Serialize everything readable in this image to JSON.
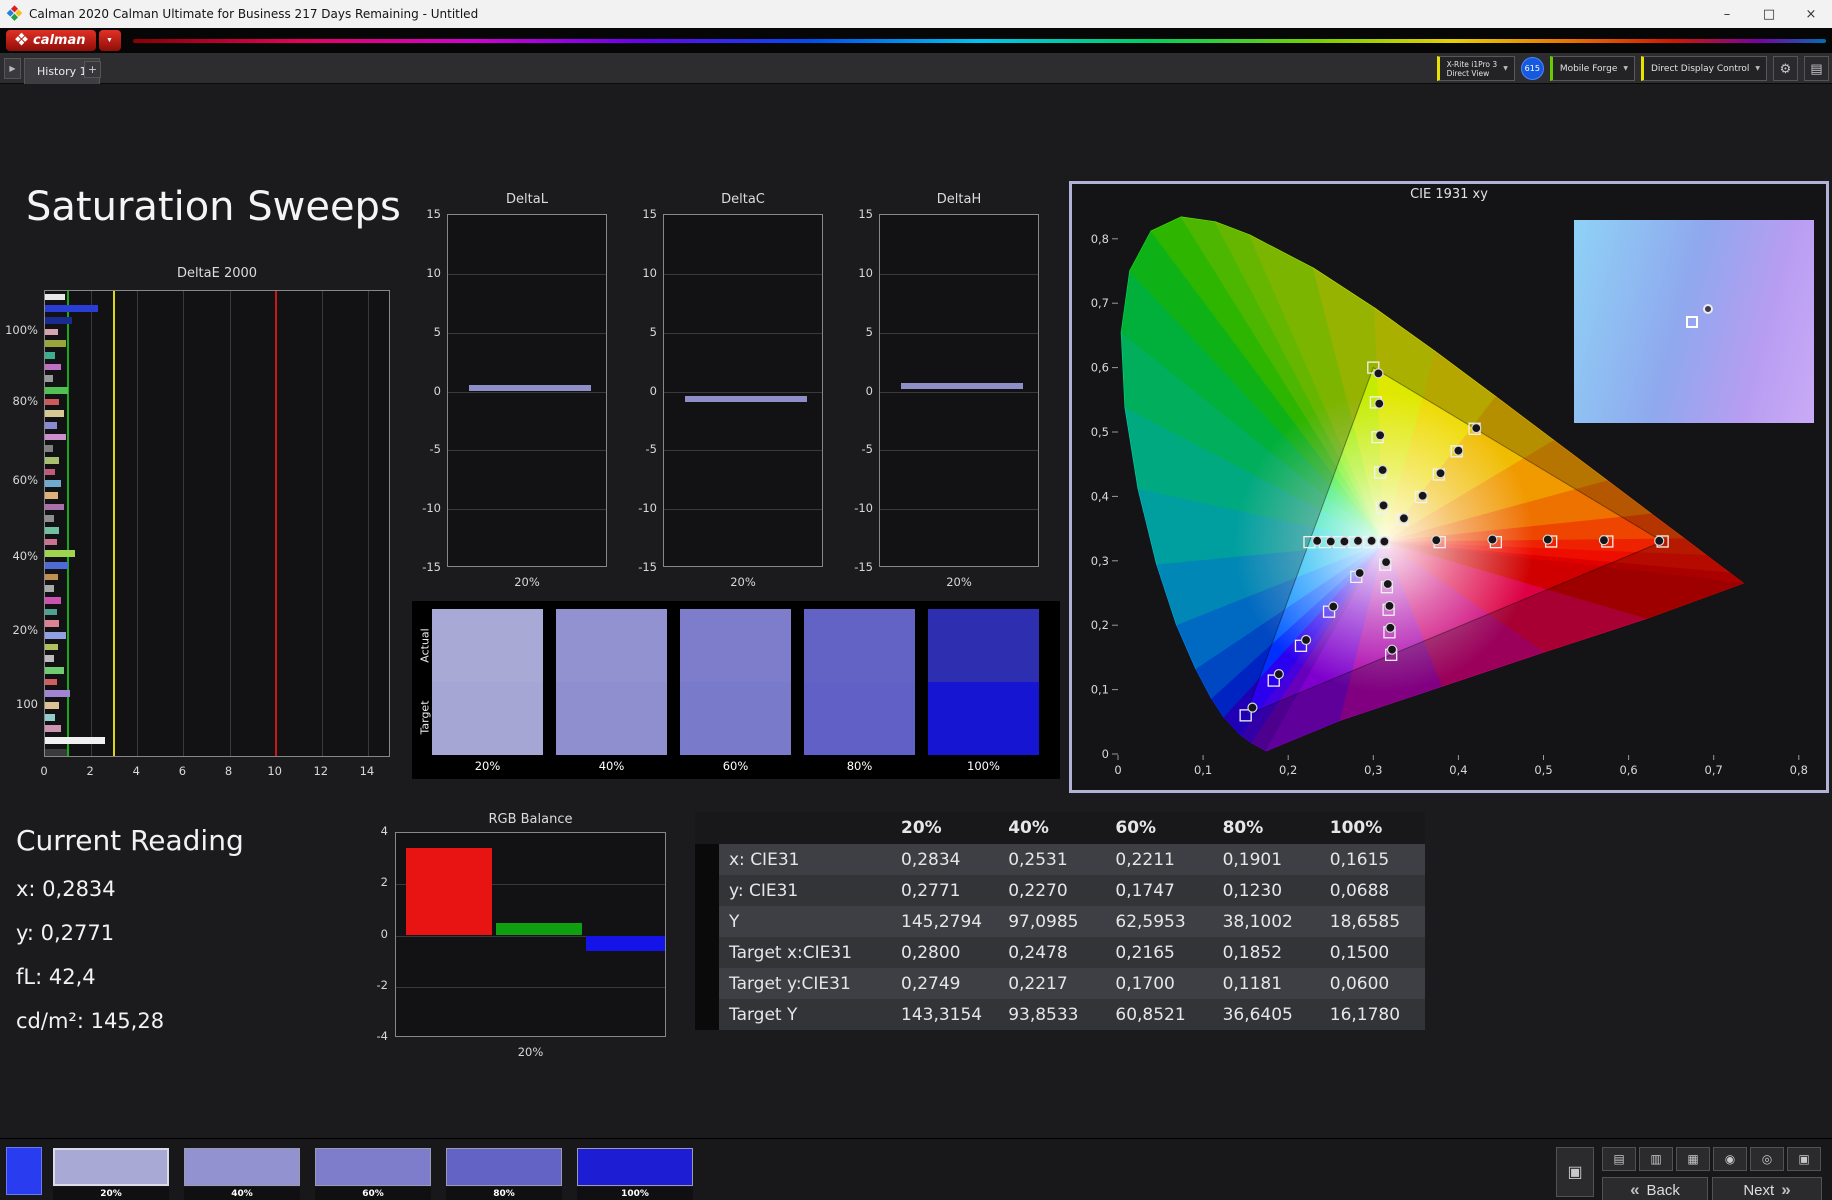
{
  "window": {
    "title": "Calman 2020 Calman Ultimate for Business 217 Days Remaining - Untitled",
    "controls": {
      "minimize": "–",
      "maximize": "□",
      "close": "×"
    }
  },
  "brand": {
    "logo_text": "calman",
    "caret": "▼"
  },
  "tab_bar": {
    "nav_glyph": "▶",
    "tab": "History 1",
    "add_tab": "+",
    "meter": {
      "line1": "X-Rite i1Pro 3",
      "line2": "Direct View",
      "stripe": "#e8e000"
    },
    "badge": "615",
    "source": {
      "label": "Mobile Forge",
      "stripe": "#66cc00"
    },
    "control": {
      "label": "Direct Display Control",
      "stripe": "#e8e000"
    },
    "gear_glyph": "⚙",
    "panel_glyph": "▤",
    "caret": "▼"
  },
  "page": {
    "title": "Saturation Sweeps"
  },
  "current_reading": {
    "title": "Current Reading",
    "lines": [
      "x: 0,2834",
      "y: 0,2771",
      "fL: 42,4",
      "cd/m²: 145,28"
    ]
  },
  "chart_data": [
    {
      "type": "bar",
      "orientation": "horizontal",
      "title": "DeltaE 2000",
      "xlim": [
        0,
        15
      ],
      "xticks": [
        0,
        2,
        4,
        6,
        8,
        10,
        12,
        14
      ],
      "group_labels": [
        "100%",
        "80%",
        "60%",
        "40%",
        "20%",
        "100"
      ],
      "group_fractions": [
        0.088,
        0.239,
        0.41,
        0.571,
        0.731,
        0.889
      ],
      "ref_lines": [
        {
          "value": 1,
          "color": "#18a818"
        },
        {
          "value": 3,
          "color": "#d8d818"
        },
        {
          "value": 10,
          "color": "#c81818"
        }
      ],
      "bars": [
        [
          "#e8e8e8",
          0.85
        ],
        [
          "#2a3dd4",
          2.3
        ],
        [
          "#1b2a8e",
          1.15
        ],
        [
          "#d6a4b0",
          0.55
        ],
        [
          "#9aa43c",
          0.9
        ],
        [
          "#3cb08e",
          0.45
        ],
        [
          "#c070c0",
          0.7
        ],
        [
          "#9a9a9a",
          0.35
        ],
        [
          "#52c052",
          1.0
        ],
        [
          "#cc5a5a",
          0.6
        ],
        [
          "#d8c894",
          0.8
        ],
        [
          "#8a8ad0",
          0.5
        ],
        [
          "#cc8ecc",
          0.9
        ],
        [
          "#808080",
          0.35
        ],
        [
          "#a6c070",
          0.6
        ],
        [
          "#c05a78",
          0.45
        ],
        [
          "#70aacc",
          0.7
        ],
        [
          "#ddb07c",
          0.55
        ],
        [
          "#aa70aa",
          0.8
        ],
        [
          "#8e8e8e",
          0.4
        ],
        [
          "#70c0a0",
          0.6
        ],
        [
          "#cc7290",
          0.5
        ],
        [
          "#a0d44e",
          1.3
        ],
        [
          "#4e6ad4",
          1.0
        ],
        [
          "#c09052",
          0.55
        ],
        [
          "#aaaaaa",
          0.4
        ],
        [
          "#cc52b0",
          0.7
        ],
        [
          "#4ea090",
          0.5
        ],
        [
          "#dd8294",
          0.6
        ],
        [
          "#90a0e0",
          0.9
        ],
        [
          "#b0c060",
          0.55
        ],
        [
          "#bcbcbc",
          0.4
        ],
        [
          "#70cc70",
          0.8
        ],
        [
          "#cc6060",
          0.5
        ],
        [
          "#a284d4",
          1.1
        ],
        [
          "#ddc094",
          0.6
        ],
        [
          "#94cccc",
          0.45
        ],
        [
          "#cc94b0",
          0.7
        ],
        [
          "#f0f0f0",
          2.6
        ],
        [
          "#3a3a3a",
          0.95
        ]
      ]
    },
    {
      "type": "bar",
      "title": "DeltaL",
      "ylim": [
        -15,
        15
      ],
      "yticks": [
        15,
        10,
        5,
        0,
        -5,
        -10,
        -15
      ],
      "categories": [
        "20%"
      ],
      "values": [
        0.3
      ],
      "color": "#8e8ec8"
    },
    {
      "type": "bar",
      "title": "DeltaC",
      "ylim": [
        -15,
        15
      ],
      "yticks": [
        15,
        10,
        5,
        0,
        -5,
        -10,
        -15
      ],
      "categories": [
        "20%"
      ],
      "values": [
        -0.6
      ],
      "color": "#8e8ec8"
    },
    {
      "type": "bar",
      "title": "DeltaH",
      "ylim": [
        -15,
        15
      ],
      "yticks": [
        15,
        10,
        5,
        0,
        -5,
        -10,
        -15
      ],
      "categories": [
        "20%"
      ],
      "values": [
        0.5
      ],
      "color": "#8e8ec8"
    },
    {
      "type": "bar",
      "title": "RGB Balance",
      "ylim": [
        -4,
        4
      ],
      "yticks": [
        4,
        2,
        0,
        -2,
        -4
      ],
      "categories": [
        "20%"
      ],
      "series": [
        {
          "name": "Red",
          "color": "#e81414",
          "values": [
            3.4
          ]
        },
        {
          "name": "Green",
          "color": "#0fa00f",
          "values": [
            0.5
          ]
        },
        {
          "name": "Blue",
          "color": "#1414e8",
          "values": [
            -0.6
          ]
        }
      ]
    },
    {
      "type": "scatter",
      "title": "CIE 1931 xy",
      "xlim": [
        0,
        0.8
      ],
      "ylim": [
        0,
        0.8
      ],
      "xticks": [
        "0",
        "0,1",
        "0,2",
        "0,3",
        "0,4",
        "0,5",
        "0,6",
        "0,7",
        "0,8"
      ],
      "yticks": [
        "0",
        "0,1",
        "0,2",
        "0,3",
        "0,4",
        "0,5",
        "0,6",
        "0,7",
        "0,8"
      ],
      "white_point": [
        0.3127,
        0.329
      ],
      "srgb_triangle": [
        [
          0.64,
          0.33
        ],
        [
          0.3,
          0.6
        ],
        [
          0.15,
          0.06
        ]
      ],
      "locus": [
        [
          0.1741,
          0.005,
          "#6600bb"
        ],
        [
          0.1566,
          0.0177,
          "#4400dd"
        ],
        [
          0.144,
          0.0297,
          "#2a00ee"
        ],
        [
          0.1241,
          0.0578,
          "#0030ff"
        ],
        [
          0.1096,
          0.0868,
          "#005eff"
        ],
        [
          0.0913,
          0.1327,
          "#008cff"
        ],
        [
          0.0687,
          0.2007,
          "#00b2f0"
        ],
        [
          0.0454,
          0.295,
          "#00d2d2"
        ],
        [
          0.0235,
          0.4127,
          "#00dfa8"
        ],
        [
          0.0082,
          0.5384,
          "#00e57a"
        ],
        [
          0.0039,
          0.6548,
          "#00e84e"
        ],
        [
          0.0139,
          0.7502,
          "#14ea1e"
        ],
        [
          0.0389,
          0.812,
          "#3cee00"
        ],
        [
          0.0743,
          0.8338,
          "#64f000"
        ],
        [
          0.1142,
          0.8262,
          "#86f000"
        ],
        [
          0.1547,
          0.8059,
          "#a4ee00"
        ],
        [
          0.2296,
          0.7543,
          "#c4ec00"
        ],
        [
          0.3016,
          0.6923,
          "#dfe800"
        ],
        [
          0.3731,
          0.6245,
          "#eeda00"
        ],
        [
          0.4441,
          0.5547,
          "#f0bc00"
        ],
        [
          0.5125,
          0.4866,
          "#f09a00"
        ],
        [
          0.5752,
          0.4242,
          "#ee7200"
        ],
        [
          0.627,
          0.3725,
          "#ee4600"
        ],
        [
          0.6658,
          0.334,
          "#ee2200"
        ],
        [
          0.6915,
          0.3083,
          "#ee0e00"
        ],
        [
          0.719,
          0.2809,
          "#e00000"
        ],
        [
          0.7347,
          0.2653,
          "#d00000"
        ],
        [
          0.62,
          0.21,
          "#dd0044"
        ],
        [
          0.5,
          0.158,
          "#cc0077"
        ],
        [
          0.38,
          0.105,
          "#aa00aa"
        ],
        [
          0.26,
          0.052,
          "#7f00cc"
        ]
      ],
      "sweeps": [
        {
          "name": "red",
          "targets": [
            [
              0.378,
              0.329
            ],
            [
              0.444,
              0.329
            ],
            [
              0.509,
              0.33
            ],
            [
              0.575,
              0.33
            ],
            [
              0.64,
              0.33
            ]
          ],
          "measured": [
            [
              0.374,
              0.332
            ],
            [
              0.44,
              0.333
            ],
            [
              0.505,
              0.333
            ],
            [
              0.571,
              0.332
            ],
            [
              0.636,
              0.331
            ]
          ]
        },
        {
          "name": "green",
          "targets": [
            [
              0.31,
              0.383
            ],
            [
              0.308,
              0.437
            ],
            [
              0.305,
              0.492
            ],
            [
              0.303,
              0.546
            ],
            [
              0.3,
              0.6
            ]
          ],
          "measured": [
            [
              0.312,
              0.386
            ],
            [
              0.311,
              0.441
            ],
            [
              0.308,
              0.495
            ],
            [
              0.307,
              0.544
            ],
            [
              0.306,
              0.591
            ]
          ]
        },
        {
          "name": "blue",
          "targets": [
            [
              0.28,
              0.275
            ],
            [
              0.248,
              0.221
            ],
            [
              0.215,
              0.168
            ],
            [
              0.183,
              0.114
            ],
            [
              0.15,
              0.06
            ]
          ],
          "measured": [
            [
              0.284,
              0.281
            ],
            [
              0.253,
              0.229
            ],
            [
              0.221,
              0.177
            ],
            [
              0.189,
              0.124
            ],
            [
              0.158,
              0.072
            ]
          ]
        },
        {
          "name": "cyan",
          "targets": [
            [
              0.295,
              0.329
            ],
            [
              0.278,
              0.329
            ],
            [
              0.26,
              0.329
            ],
            [
              0.243,
              0.329
            ],
            [
              0.225,
              0.329
            ]
          ],
          "measured": [
            [
              0.298,
              0.331
            ],
            [
              0.282,
              0.331
            ],
            [
              0.266,
              0.33
            ],
            [
              0.25,
              0.33
            ],
            [
              0.234,
              0.331
            ]
          ]
        },
        {
          "name": "magenta",
          "targets": [
            [
              0.314,
              0.294
            ],
            [
              0.316,
              0.259
            ],
            [
              0.318,
              0.224
            ],
            [
              0.319,
              0.189
            ],
            [
              0.321,
              0.154
            ]
          ],
          "measured": [
            [
              0.315,
              0.298
            ],
            [
              0.317,
              0.264
            ],
            [
              0.319,
              0.23
            ],
            [
              0.32,
              0.196
            ],
            [
              0.322,
              0.162
            ]
          ]
        },
        {
          "name": "yellow",
          "targets": [
            [
              0.334,
              0.364
            ],
            [
              0.356,
              0.399
            ],
            [
              0.377,
              0.434
            ],
            [
              0.398,
              0.47
            ],
            [
              0.419,
              0.505
            ]
          ],
          "measured": [
            [
              0.336,
              0.366
            ],
            [
              0.358,
              0.401
            ],
            [
              0.379,
              0.436
            ],
            [
              0.4,
              0.471
            ],
            [
              0.421,
              0.506
            ]
          ]
        }
      ],
      "white_measured": [
        0.313,
        0.33
      ],
      "inset": {
        "gradient": [
          "#8fd2f6",
          "#8fa8ee",
          "#b79df2",
          "#c9aaf6"
        ],
        "target": [
          0.49,
          0.5
        ],
        "measured": [
          0.56,
          0.44
        ]
      }
    }
  ],
  "swatches": {
    "row_labels": [
      "Actual",
      "Target"
    ],
    "levels": [
      "20%",
      "40%",
      "60%",
      "80%",
      "100%"
    ],
    "actual": [
      "#a9a9d6",
      "#9292d0",
      "#7d7dcb",
      "#6363c6",
      "#2e2eb0"
    ],
    "target": [
      "#a6a6d4",
      "#8f8fd0",
      "#7a7acb",
      "#6060c6",
      "#1616d2"
    ]
  },
  "table": {
    "headers": [
      "20%",
      "40%",
      "60%",
      "80%",
      "100%"
    ],
    "rows": [
      {
        "label": "x: CIE31",
        "values": [
          "0,2834",
          "0,2531",
          "0,2211",
          "0,1901",
          "0,1615"
        ]
      },
      {
        "label": "y: CIE31",
        "values": [
          "0,2771",
          "0,2270",
          "0,1747",
          "0,1230",
          "0,0688"
        ]
      },
      {
        "label": "Y",
        "values": [
          "145,2794",
          "97,0985",
          "62,5953",
          "38,1002",
          "18,6585"
        ]
      },
      {
        "label": "Target x:CIE31",
        "values": [
          "0,2800",
          "0,2478",
          "0,2165",
          "0,1852",
          "0,1500"
        ]
      },
      {
        "label": "Target y:CIE31",
        "values": [
          "0,2749",
          "0,2217",
          "0,1700",
          "0,1181",
          "0,0600"
        ]
      },
      {
        "label": "Target Y",
        "values": [
          "143,3154",
          "93,8533",
          "60,8521",
          "36,6405",
          "16,1780"
        ]
      }
    ]
  },
  "bottom": {
    "current_patch_color": "#2a3cf0",
    "levels": [
      "20%",
      "40%",
      "60%",
      "80%",
      "100%"
    ],
    "colors": [
      "#a9a9d6",
      "#9292d0",
      "#7d7dcb",
      "#6363c6",
      "#1d1dd4"
    ],
    "display_button": {
      "name": "display-icon",
      "glyph": "▣"
    },
    "tools": [
      {
        "name": "bar-chart-icon",
        "glyph": "▤"
      },
      {
        "name": "layout-icon",
        "glyph": "▥"
      },
      {
        "name": "grid-icon",
        "glyph": "▦"
      },
      {
        "name": "record-icon",
        "glyph": "◉"
      },
      {
        "name": "target-icon",
        "glyph": "◎"
      },
      {
        "name": "screen-icon",
        "glyph": "▣"
      }
    ],
    "back_chevron": "«",
    "back_label": "Back",
    "next_label": "Next",
    "next_chevron": "»"
  }
}
